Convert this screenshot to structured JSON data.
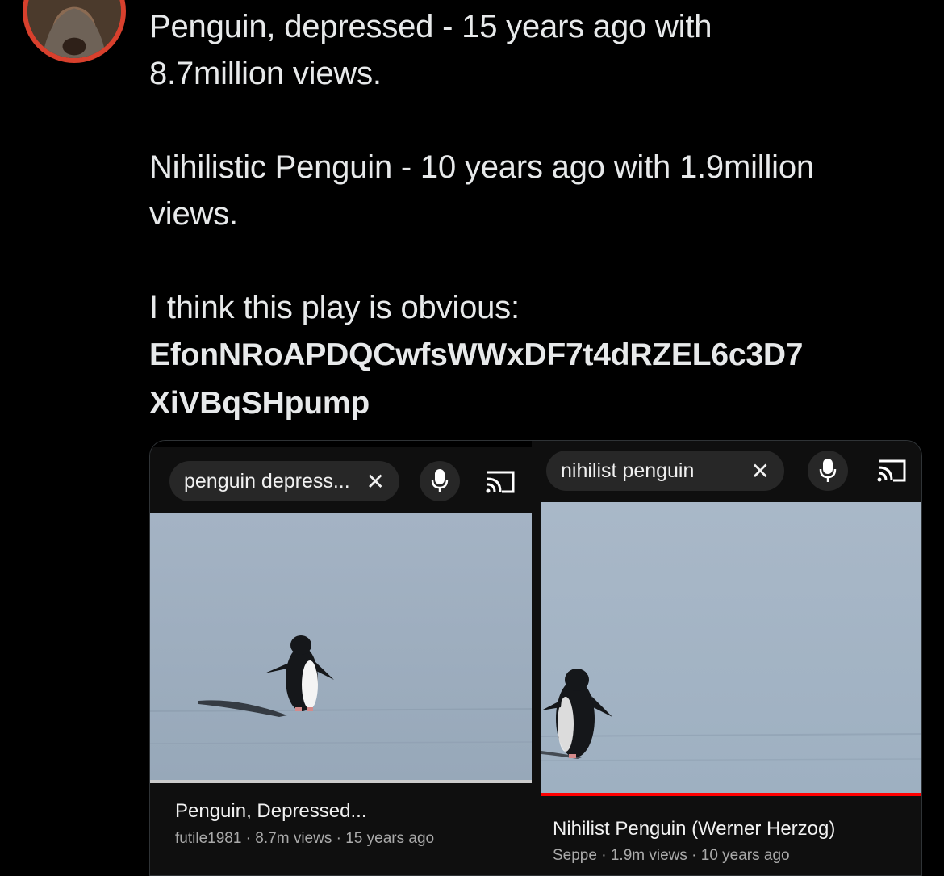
{
  "tweet": {
    "line1": "Penguin, depressed - 15 years ago with",
    "line2": "8.7million views.",
    "line3": "Nihilistic Penguin - 10 years ago with 1.9million",
    "line4": "views.",
    "line5": "I think this play is obvious:",
    "ca_line1": "EfonNRoAPDQCwfsWWxDF7t4dRZEL6c3D7",
    "ca_line2": "XiVBqSHpump"
  },
  "left_panel": {
    "search_query": "penguin depress...",
    "clear_glyph": "✕",
    "video_title": "Penguin, Depressed...",
    "channel": "futile1981",
    "views": "8.7m views",
    "age": "15 years ago",
    "separator": " · ",
    "progress_color": "#cccccc"
  },
  "right_panel": {
    "search_query": "nihilist penguin",
    "clear_glyph": "✕",
    "video_title": "Nihilist Penguin (Werner Herzog)",
    "channel": "Seppe",
    "views": "1.9m views",
    "age": "10 years ago",
    "separator": " · ",
    "progress_color": "#ff0000"
  },
  "icons": {
    "mic": "microphone-icon",
    "cast": "cast-icon",
    "clear": "close-icon"
  }
}
